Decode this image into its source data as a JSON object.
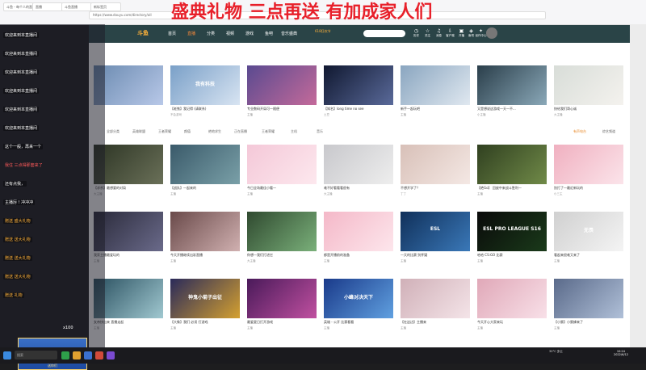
{
  "browser": {
    "url": "https://www.douyu.com/directory/all",
    "tabs": [
      "斗鱼 - 每个人的直播平台",
      "直播",
      "斗鱼直播",
      "新标签页"
    ]
  },
  "banner": {
    "text": "盛典礼物 三点再送 有加成家人们",
    "color": "#e8202a"
  },
  "nav": {
    "logo": "斗鱼",
    "items": [
      "首页",
      "直播",
      "分类",
      "视频",
      "游戏",
      "鱼吧",
      "音乐盛典"
    ],
    "active": 1,
    "badge": "618狂欢节",
    "icons": [
      {
        "label": "历史",
        "icon": "clock-icon"
      },
      {
        "label": "关注",
        "icon": "star-icon"
      },
      {
        "label": "消息",
        "icon": "bell-icon"
      },
      {
        "label": "客户端",
        "icon": "download-icon"
      },
      {
        "label": "开播",
        "icon": "camera-icon"
      },
      {
        "label": "鱼吧",
        "icon": "fish-icon"
      },
      {
        "label": "创作中心",
        "icon": "bulb-icon"
      }
    ]
  },
  "filters": {
    "items": [
      "全部分类",
      "英雄联盟",
      "王者荣耀",
      "颜值",
      "绝地求生",
      "正在直播",
      "王者荣耀",
      "主机",
      "音乐"
    ],
    "right": [
      "有声电台",
      "综艺频道"
    ]
  },
  "cards": [
    {
      "title": "",
      "meta": "",
      "c1": "#6a8ab0",
      "c2": "#b8c8e8",
      "text": ""
    },
    {
      "title": "【老铁】我记得 (请联系)",
      "meta": "不会游戏",
      "c1": "#7aa0c8",
      "c2": "#d8e4f2",
      "text": "我有科技"
    },
    {
      "title": "专业数码开局可—随便",
      "meta": "主播",
      "c1": "#5a4a90",
      "c2": "#c46a9a",
      "text": ""
    },
    {
      "title": "【知名】long time no see",
      "meta": "土豆",
      "c1": "#101830",
      "c2": "#5a6a9a",
      "text": ""
    },
    {
      "title": "新手一起玩吧",
      "meta": "主播",
      "c1": "#8aa6c0",
      "c2": "#e0e8f0",
      "text": ""
    },
    {
      "title": "又是想说这游戏一天一不...",
      "meta": "小主播",
      "c1": "#2a3e4a",
      "c2": "#8aa8b8",
      "text": ""
    },
    {
      "title": "快给我们哥心诚",
      "meta": "大主播",
      "c1": "#d8ddd8",
      "c2": "#f4f2ee",
      "text": ""
    },
    {
      "title": "【求杀】最想要的对局",
      "meta": "大主播",
      "c1": "#2c3424",
      "c2": "#6a7058",
      "text": ""
    },
    {
      "title": "【战队】一起来的",
      "meta": "主播",
      "c1": "#3a5a6a",
      "c2": "#7aa0a8",
      "text": ""
    },
    {
      "title": "今日全场最佳小看一",
      "meta": "主播",
      "c1": "#f4c8d8",
      "c2": "#fde8ee",
      "text": ""
    },
    {
      "title": "难不好看看看很有",
      "meta": "大主播",
      "c1": "#c8c8cc",
      "c2": "#eeeeee",
      "text": ""
    },
    {
      "title": "不想开学了？",
      "meta": "丁丁",
      "c1": "#d8c0b8",
      "c2": "#f4e8e4",
      "text": ""
    },
    {
      "title": "【绝Go】 回放中来战斗胜利一",
      "meta": "主播",
      "c1": "#304020",
      "c2": "#708a48",
      "text": ""
    },
    {
      "title": "别打了—最近新玩的",
      "meta": "小三主",
      "c1": "#f0b0c0",
      "c2": "#fbe4ea",
      "text": ""
    },
    {
      "title": "我家主播最爱玩的",
      "meta": "主播",
      "c1": "#2a2a3a",
      "c2": "#6a6a8a",
      "text": ""
    },
    {
      "title": "今天开播继续出彩直播",
      "meta": "主播",
      "c1": "#6a4a4a",
      "c2": "#d0b0b0",
      "text": ""
    },
    {
      "title": "你想—我们打进它",
      "meta": "大主播",
      "c1": "#304a30",
      "c2": "#7ab07a",
      "text": ""
    },
    {
      "title": "都是开播前的准备",
      "meta": "主播",
      "c1": "#f4b8c8",
      "c2": "#fde6ec",
      "text": ""
    },
    {
      "title": "一天的比赛 别怀疑",
      "meta": "主播",
      "c1": "#10305a",
      "c2": "#3a78b8",
      "text": "ESL"
    },
    {
      "title": "哈哈 CS:GO 比赛",
      "meta": "主播",
      "c1": "#0a0a0a",
      "c2": "#1a3a1a",
      "text": "ESL PRO LEAGUE S16"
    },
    {
      "title": "看起来很难又来了",
      "meta": "主播",
      "c1": "#d0d0d0",
      "c2": "#f4f4f4",
      "text": "无畏"
    },
    {
      "title": "女帝快出来 直播走起",
      "meta": "主播",
      "c1": "#2a5060",
      "c2": "#a0c8d0",
      "text": ""
    },
    {
      "title": "【大象】我们 必须 打游戏",
      "meta": "主播",
      "c1": "#2a2a5a",
      "c2": "#d4a030",
      "text": "神鬼小菊子出征"
    },
    {
      "title": "最爱夏日打开游戏",
      "meta": "主播",
      "c1": "#4a1a5a",
      "c2": "#c050a0",
      "text": ""
    },
    {
      "title": "英雄 - 公开 比赛看看",
      "meta": "主播",
      "c1": "#1a3a8a",
      "c2": "#60a0e0",
      "text": "小峰对决天下"
    },
    {
      "title": "【在这边】主播来",
      "meta": "主播",
      "c1": "#d0b0b8",
      "c2": "#f4e4e8",
      "text": ""
    },
    {
      "title": "今天开心大家来玩",
      "meta": "主播",
      "c1": "#e0a8b8",
      "c2": "#f8e0e8",
      "text": ""
    },
    {
      "title": "【小蜜】小蜜蜂来了",
      "meta": "主播",
      "c1": "#5a6a8a",
      "c2": "#b0c0d8",
      "text": ""
    }
  ],
  "chat": {
    "messages": [
      {
        "text": "欢迎来到本直播间",
        "style": "white"
      },
      {
        "text": "欢迎来到本直播间",
        "style": "white"
      },
      {
        "text": "欢迎来到本直播间",
        "style": "white"
      },
      {
        "text": "欢迎来到本直播间",
        "style": "white"
      },
      {
        "text": "欢迎来到本直播间",
        "style": "white"
      },
      {
        "text": "欢迎来到本直播间",
        "style": "white"
      },
      {
        "text": "这个一般，再来一个",
        "style": "white"
      },
      {
        "text": "我住 三点得那套来了",
        "style": "red"
      },
      {
        "text": "还有点我，",
        "style": "white"
      },
      {
        "text": "主播厉 ! 冲冲冲",
        "style": "white"
      },
      {
        "text": "赠送 盛大礼物",
        "style": "orange"
      },
      {
        "text": "赠送 送大礼物",
        "style": "orange"
      },
      {
        "text": "赠送 送大礼物",
        "style": "orange"
      },
      {
        "text": "赠送 送大礼物",
        "style": "orange"
      },
      {
        "text": "赠送 礼物",
        "style": "orange"
      }
    ],
    "count": "x100",
    "banner_text": "送你们"
  },
  "taskbar": {
    "search": "搜索",
    "weather": "30°C 多云",
    "time": "10:24",
    "date": "2022/6/12"
  }
}
